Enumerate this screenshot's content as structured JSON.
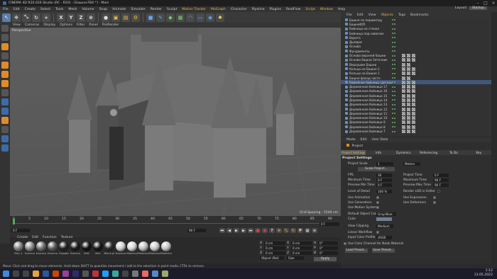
{
  "app": {
    "title": "CINEMA 4D R20.026 Studio (RC - R20) - [Башня.FBX *] - Main"
  },
  "menubar": {
    "items": [
      "File",
      "Edit",
      "Create",
      "Select",
      "Tools",
      "Mesh",
      "Volume",
      "Snap",
      "Animate",
      "Simulate",
      "Render",
      "Sculpt",
      "Motion Tracker",
      "MoGraph",
      "Character",
      "Pipeline",
      "Plugins",
      "RealFlow",
      "Script",
      "Window",
      "Help"
    ],
    "layout_label": "Layout:",
    "layout_value": "Startup"
  },
  "toolbar": {
    "buttons": [
      "pointer",
      "move",
      "scale",
      "rotate",
      "X",
      "Y",
      "Z",
      "coord",
      "play-anim",
      "render",
      "render-view",
      "render-settings",
      "cube",
      "pen",
      "subdiv",
      "array",
      "deformer",
      "floor",
      "camera",
      "light"
    ]
  },
  "viewport": {
    "header": [
      "View",
      "Cameras",
      "Display",
      "Options",
      "Filter",
      "Panel",
      "ProRender"
    ],
    "label": "Perspective",
    "grid_spacing": "Grid Spacing : 1540 cm"
  },
  "timeline": {
    "ticks": [
      "0",
      "5",
      "10",
      "15",
      "20",
      "25",
      "30",
      "35",
      "40",
      "45",
      "50",
      "55",
      "60",
      "65",
      "70",
      "75",
      "80",
      "85",
      "90"
    ],
    "start": "0 F",
    "end": "90 F",
    "current": "0 F",
    "end2": "90 F"
  },
  "materials": {
    "menu": [
      "Create",
      "Edit",
      "Function",
      "Texture"
    ],
    "items": [
      {
        "label": "Мат.1",
        "color": "#7f7f7f"
      },
      {
        "label": "Колесо",
        "color": "#8a8a8a"
      },
      {
        "label": "Колесо",
        "color": "#6f6f6f"
      },
      {
        "label": "Колесо",
        "color": "#5a5a5a"
      },
      {
        "label": "Подвес",
        "color": "#222222"
      },
      {
        "label": "Колесо",
        "color": "#1a1a1a"
      },
      {
        "label": "Изб",
        "color": "#111111"
      },
      {
        "label": "Мат",
        "color": "#151515"
      },
      {
        "label": "Black.pl",
        "color": "#2a2a2a"
      },
      {
        "label": "Колесо",
        "color": "#cfcfcf"
      },
      {
        "label": "Material",
        "color": "#d6d6d6"
      },
      {
        "label": "Material",
        "color": "#bdbdbd"
      },
      {
        "label": "Material",
        "color": "#c9c9c9"
      },
      {
        "label": "Material",
        "color": "#c2c2c2"
      }
    ]
  },
  "coords": {
    "rows": [
      {
        "a": "X",
        "av": "0 cm",
        "b": "X",
        "bv": "0 cm",
        "c": "H",
        "cv": "0°"
      },
      {
        "a": "Y",
        "av": "0 cm",
        "b": "Y",
        "bv": "0 cm",
        "c": "P",
        "cv": "0°"
      },
      {
        "a": "Z",
        "av": "0 cm",
        "b": "Z",
        "bv": "0 cm",
        "c": "B",
        "cv": "0°"
      }
    ],
    "mode": "Object (Rel)",
    "size": "Size",
    "apply": "Apply"
  },
  "statusbar": {
    "text": "Move: Click and drag to move elements. Hold down SHIFT to quantize movement / add to the selection in point mode, CTRL to remove."
  },
  "object_manager": {
    "menu": [
      "File",
      "Edit",
      "View",
      "Objects",
      "Tags",
      "Bookmarks"
    ],
    "objects": [
      {
        "name": "Башня по периметру",
        "tex": 0
      },
      {
        "name": "Башня005",
        "tex": 0
      },
      {
        "name": "Бойница на стенах",
        "tex": 0
      },
      {
        "name": "Бойница под навесом",
        "tex": 0
      },
      {
        "name": "Ворота",
        "tex": 0
      },
      {
        "name": "Дымари",
        "tex": 0
      },
      {
        "name": "Основа",
        "tex": 0
      },
      {
        "name": "Фундаменты",
        "tex": 0
      },
      {
        "name": "Основа верхней башни",
        "tex": 3
      },
      {
        "name": "Основа башни Заточник",
        "tex": 3
      },
      {
        "name": "Верхушки Башни",
        "tex": 2
      },
      {
        "name": "Кольцо на Башне 2",
        "tex": 3
      },
      {
        "name": "Кольцо на Башне 1",
        "tex": 3
      },
      {
        "name": "Башня фасад частн",
        "tex": 2
      },
      {
        "name": "Рифлёнок бойница (деталь)",
        "tex": 3
      },
      {
        "name": "Деревянная бойница 17",
        "tex": 3
      },
      {
        "name": "Деревянная бойница 16",
        "tex": 3
      },
      {
        "name": "Деревянная бойница 15",
        "tex": 3
      },
      {
        "name": "Деревянная бойница 14",
        "tex": 3
      },
      {
        "name": "Деревянная бойница 13",
        "tex": 3
      },
      {
        "name": "Деревянная бойница 12",
        "tex": 3
      },
      {
        "name": "Деревянная бойница 11",
        "tex": 3
      },
      {
        "name": "Деревянная бойница 10",
        "tex": 3
      },
      {
        "name": "Деревянная бойница 9",
        "tex": 3
      },
      {
        "name": "Деревянная бойница 8",
        "tex": 3
      },
      {
        "name": "Деревянная бойница 7",
        "tex": 3
      }
    ]
  },
  "attribute_manager": {
    "menu": [
      "Mode",
      "Edit",
      "User Data"
    ],
    "title": "Project",
    "tabs": [
      "Project Settings",
      "Info",
      "Dynamics",
      "Referencing",
      "To Do",
      "Key Interpolation"
    ],
    "section": "Project Settings",
    "project_scale_label": "Project Scale",
    "project_scale_value": "1",
    "project_scale_unit": "Meters",
    "scale_project_btn": "Scale Project...",
    "fps_label": "FPS",
    "fps": "30",
    "project_time_label": "Project Time",
    "project_time": "0 F",
    "min_time_label": "Minimum Time",
    "min_time": "0 F",
    "max_time_label": "Maximum Time",
    "max_time": "90 F",
    "prev_min_label": "Preview Min Time",
    "prev_min": "0 F",
    "prev_max_label": "Preview Max Time",
    "prev_max": "90 F",
    "lod_label": "Level of Detail",
    "lod": "100 %",
    "render_lod_label": "Render LOD in Editor",
    "use_animation": "Use Animation",
    "use_expression": "Use Expression",
    "use_generators": "Use Generators",
    "use_deformers": "Use Deformers",
    "use_motion": "Use Motion System",
    "default_color_label": "Default Object Color",
    "default_color_value": "Gray-Blue",
    "color_label": "Color",
    "view_clipping_label": "View Clipping",
    "view_clipping_value": "Medium",
    "linear_workflow": "Linear Workflow",
    "input_color_label": "Input Color Profile",
    "input_color_value": "sRGB",
    "color_channel": "Use Color Channel for Node Material",
    "load_preset": "Load Preset...",
    "save_preset": "Save Preset..."
  },
  "taskbar": {
    "time": "1:12",
    "date": "13.05.2022"
  },
  "colors": {
    "accent": "#f0b34a",
    "selection": "#41577a"
  }
}
